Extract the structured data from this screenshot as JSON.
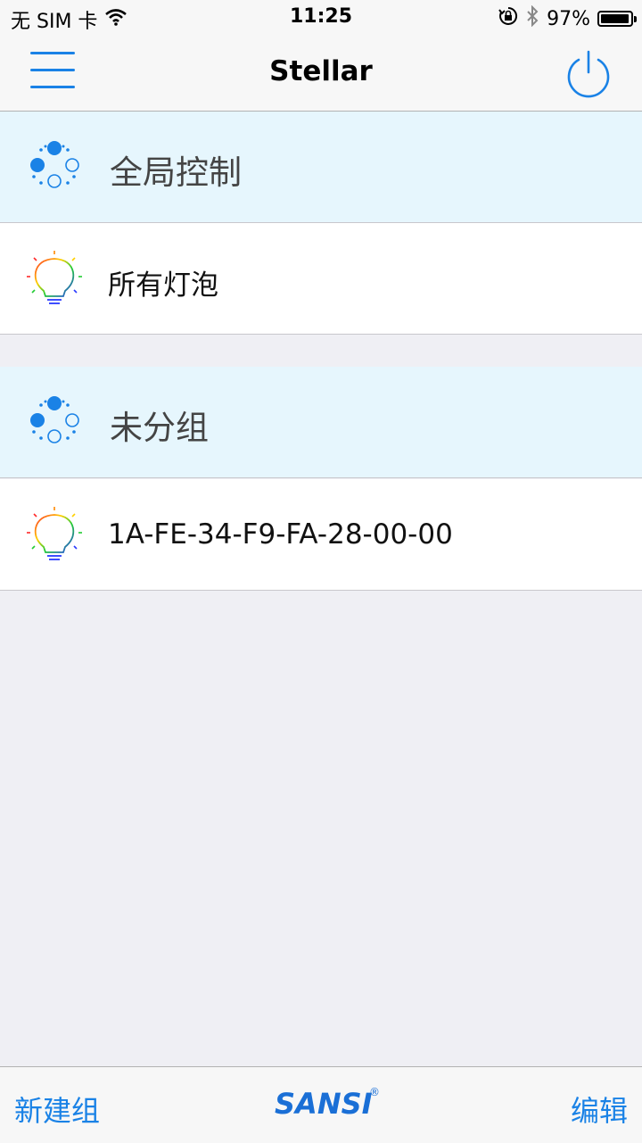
{
  "status_bar": {
    "carrier": "无 SIM 卡",
    "time": "11:25",
    "battery_percent": "97%",
    "battery_level": 0.97,
    "icons": [
      "wifi-icon",
      "orientation-lock-icon",
      "bluetooth-icon",
      "battery-icon"
    ]
  },
  "nav": {
    "title": "Stellar",
    "left_icon": "menu-icon",
    "right_icon": "power-icon"
  },
  "sections": [
    {
      "group_label": "全局控制",
      "group_icon": "group-dots-icon",
      "items": [
        {
          "label": "所有灯泡",
          "icon": "rgb-bulb-icon"
        }
      ]
    },
    {
      "group_label": "未分组",
      "group_icon": "group-dots-icon",
      "items": [
        {
          "label": "1A-FE-34-F9-FA-28-00-00",
          "icon": "rgb-bulb-icon"
        }
      ]
    }
  ],
  "toolbar": {
    "new_group_label": "新建组",
    "edit_label": "编辑",
    "brand": "SANSI",
    "brand_mark": "®"
  },
  "colors": {
    "accent": "#1a82e6",
    "group_bg": "#e6f6fd",
    "background": "#efeff4"
  }
}
